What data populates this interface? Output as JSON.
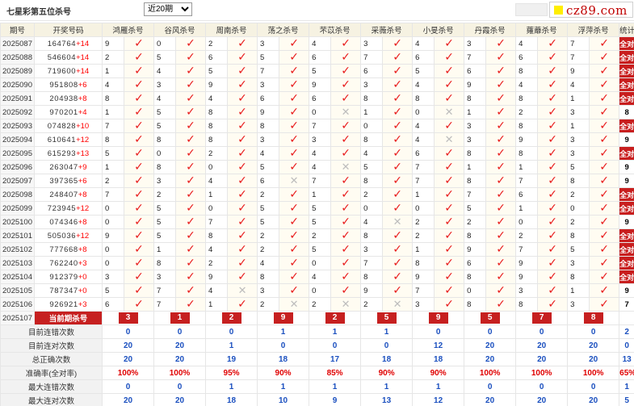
{
  "page": {
    "title": "七星彩第五位杀号",
    "period_option": "近20期",
    "logo_text": "cz89.com"
  },
  "headers": [
    "期号",
    "开奖号码",
    "鸿雁杀号",
    "谷风杀号",
    "周南杀号",
    "荡之杀号",
    "芣苡杀号",
    "采薇杀号",
    "小旻杀号",
    "丹霞杀号",
    "蕹蘼杀号",
    "浮萍杀号",
    "统计"
  ],
  "rows": [
    {
      "period": "2025087",
      "draw": "164764",
      "sum": "+14",
      "cells": [
        {
          "v": "9",
          "ok": true
        },
        {
          "v": "0",
          "ok": true
        },
        {
          "v": "2",
          "ok": true
        },
        {
          "v": "3",
          "ok": true
        },
        {
          "v": "4",
          "ok": true
        },
        {
          "v": "3",
          "ok": true
        },
        {
          "v": "4",
          "ok": true
        },
        {
          "v": "3",
          "ok": true
        },
        {
          "v": "4",
          "ok": true
        },
        {
          "v": "7",
          "ok": true
        }
      ],
      "stat": "全对"
    },
    {
      "period": "2025088",
      "draw": "546604",
      "sum": "+14",
      "cells": [
        {
          "v": "2",
          "ok": true
        },
        {
          "v": "5",
          "ok": true
        },
        {
          "v": "6",
          "ok": true
        },
        {
          "v": "5",
          "ok": true
        },
        {
          "v": "6",
          "ok": true
        },
        {
          "v": "7",
          "ok": true
        },
        {
          "v": "6",
          "ok": true
        },
        {
          "v": "7",
          "ok": true
        },
        {
          "v": "6",
          "ok": true
        },
        {
          "v": "7",
          "ok": true
        }
      ],
      "stat": "全对"
    },
    {
      "period": "2025089",
      "draw": "719600",
      "sum": "+14",
      "cells": [
        {
          "v": "1",
          "ok": true
        },
        {
          "v": "4",
          "ok": true
        },
        {
          "v": "5",
          "ok": true
        },
        {
          "v": "7",
          "ok": true
        },
        {
          "v": "5",
          "ok": true
        },
        {
          "v": "6",
          "ok": true
        },
        {
          "v": "5",
          "ok": true
        },
        {
          "v": "6",
          "ok": true
        },
        {
          "v": "8",
          "ok": true
        },
        {
          "v": "9",
          "ok": true
        }
      ],
      "stat": "全对"
    },
    {
      "period": "2025090",
      "draw": "951808",
      "sum": "+6",
      "cells": [
        {
          "v": "4",
          "ok": true
        },
        {
          "v": "3",
          "ok": true
        },
        {
          "v": "9",
          "ok": true
        },
        {
          "v": "3",
          "ok": true
        },
        {
          "v": "9",
          "ok": true
        },
        {
          "v": "3",
          "ok": true
        },
        {
          "v": "4",
          "ok": true
        },
        {
          "v": "9",
          "ok": true
        },
        {
          "v": "4",
          "ok": true
        },
        {
          "v": "4",
          "ok": true
        }
      ],
      "stat": "全对"
    },
    {
      "period": "2025091",
      "draw": "204938",
      "sum": "+8",
      "cells": [
        {
          "v": "8",
          "ok": true
        },
        {
          "v": "4",
          "ok": true
        },
        {
          "v": "4",
          "ok": true
        },
        {
          "v": "6",
          "ok": true
        },
        {
          "v": "6",
          "ok": true
        },
        {
          "v": "8",
          "ok": true
        },
        {
          "v": "8",
          "ok": true
        },
        {
          "v": "8",
          "ok": true
        },
        {
          "v": "8",
          "ok": true
        },
        {
          "v": "1",
          "ok": true
        }
      ],
      "stat": "全对"
    },
    {
      "period": "2025092",
      "draw": "970201",
      "sum": "+4",
      "cells": [
        {
          "v": "1",
          "ok": true
        },
        {
          "v": "5",
          "ok": true
        },
        {
          "v": "8",
          "ok": true
        },
        {
          "v": "9",
          "ok": true
        },
        {
          "v": "0",
          "ok": false
        },
        {
          "v": "1",
          "ok": true
        },
        {
          "v": "0",
          "ok": false
        },
        {
          "v": "1",
          "ok": true
        },
        {
          "v": "2",
          "ok": true
        },
        {
          "v": "3",
          "ok": true
        }
      ],
      "stat": "8"
    },
    {
      "period": "2025093",
      "draw": "074828",
      "sum": "+10",
      "cells": [
        {
          "v": "7",
          "ok": true
        },
        {
          "v": "5",
          "ok": true
        },
        {
          "v": "8",
          "ok": true
        },
        {
          "v": "8",
          "ok": true
        },
        {
          "v": "7",
          "ok": true
        },
        {
          "v": "0",
          "ok": true
        },
        {
          "v": "4",
          "ok": true
        },
        {
          "v": "3",
          "ok": true
        },
        {
          "v": "8",
          "ok": true
        },
        {
          "v": "1",
          "ok": true
        }
      ],
      "stat": "全对"
    },
    {
      "period": "2025094",
      "draw": "610641",
      "sum": "+12",
      "cells": [
        {
          "v": "8",
          "ok": true
        },
        {
          "v": "8",
          "ok": true
        },
        {
          "v": "8",
          "ok": true
        },
        {
          "v": "3",
          "ok": true
        },
        {
          "v": "3",
          "ok": true
        },
        {
          "v": "8",
          "ok": true
        },
        {
          "v": "4",
          "ok": false
        },
        {
          "v": "3",
          "ok": true
        },
        {
          "v": "9",
          "ok": true
        },
        {
          "v": "3",
          "ok": true
        }
      ],
      "stat": "9"
    },
    {
      "period": "2025095",
      "draw": "615293",
      "sum": "+13",
      "cells": [
        {
          "v": "5",
          "ok": true
        },
        {
          "v": "0",
          "ok": true
        },
        {
          "v": "2",
          "ok": true
        },
        {
          "v": "4",
          "ok": true
        },
        {
          "v": "4",
          "ok": true
        },
        {
          "v": "4",
          "ok": true
        },
        {
          "v": "6",
          "ok": true
        },
        {
          "v": "8",
          "ok": true
        },
        {
          "v": "8",
          "ok": true
        },
        {
          "v": "3",
          "ok": true
        }
      ],
      "stat": "全对"
    },
    {
      "period": "2025096",
      "draw": "263047",
      "sum": "+9",
      "cells": [
        {
          "v": "1",
          "ok": true
        },
        {
          "v": "8",
          "ok": true
        },
        {
          "v": "0",
          "ok": true
        },
        {
          "v": "5",
          "ok": true
        },
        {
          "v": "4",
          "ok": false
        },
        {
          "v": "5",
          "ok": true
        },
        {
          "v": "7",
          "ok": true
        },
        {
          "v": "1",
          "ok": true
        },
        {
          "v": "1",
          "ok": true
        },
        {
          "v": "5",
          "ok": true
        }
      ],
      "stat": "9"
    },
    {
      "period": "2025097",
      "draw": "397365",
      "sum": "+6",
      "cells": [
        {
          "v": "2",
          "ok": true
        },
        {
          "v": "3",
          "ok": true
        },
        {
          "v": "4",
          "ok": true
        },
        {
          "v": "6",
          "ok": false
        },
        {
          "v": "7",
          "ok": true
        },
        {
          "v": "8",
          "ok": true
        },
        {
          "v": "7",
          "ok": true
        },
        {
          "v": "8",
          "ok": true
        },
        {
          "v": "7",
          "ok": true
        },
        {
          "v": "8",
          "ok": true
        }
      ],
      "stat": "9"
    },
    {
      "period": "2025098",
      "draw": "248407",
      "sum": "+8",
      "cells": [
        {
          "v": "7",
          "ok": true
        },
        {
          "v": "2",
          "ok": true
        },
        {
          "v": "1",
          "ok": true
        },
        {
          "v": "2",
          "ok": true
        },
        {
          "v": "1",
          "ok": true
        },
        {
          "v": "2",
          "ok": true
        },
        {
          "v": "1",
          "ok": true
        },
        {
          "v": "7",
          "ok": true
        },
        {
          "v": "6",
          "ok": true
        },
        {
          "v": "2",
          "ok": true
        }
      ],
      "stat": "全对"
    },
    {
      "period": "2025099",
      "draw": "723945",
      "sum": "+12",
      "cells": [
        {
          "v": "0",
          "ok": true
        },
        {
          "v": "5",
          "ok": true
        },
        {
          "v": "0",
          "ok": true
        },
        {
          "v": "5",
          "ok": true
        },
        {
          "v": "5",
          "ok": true
        },
        {
          "v": "0",
          "ok": true
        },
        {
          "v": "0",
          "ok": true
        },
        {
          "v": "5",
          "ok": true
        },
        {
          "v": "1",
          "ok": true
        },
        {
          "v": "0",
          "ok": true
        }
      ],
      "stat": "全对"
    },
    {
      "period": "2025100",
      "draw": "074346",
      "sum": "+8",
      "cells": [
        {
          "v": "0",
          "ok": true
        },
        {
          "v": "5",
          "ok": true
        },
        {
          "v": "7",
          "ok": true
        },
        {
          "v": "5",
          "ok": true
        },
        {
          "v": "5",
          "ok": true
        },
        {
          "v": "4",
          "ok": false
        },
        {
          "v": "2",
          "ok": true
        },
        {
          "v": "2",
          "ok": true
        },
        {
          "v": "0",
          "ok": true
        },
        {
          "v": "2",
          "ok": true
        }
      ],
      "stat": "9"
    },
    {
      "period": "2025101",
      "draw": "505036",
      "sum": "+12",
      "cells": [
        {
          "v": "9",
          "ok": true
        },
        {
          "v": "5",
          "ok": true
        },
        {
          "v": "8",
          "ok": true
        },
        {
          "v": "2",
          "ok": true
        },
        {
          "v": "2",
          "ok": true
        },
        {
          "v": "8",
          "ok": true
        },
        {
          "v": "2",
          "ok": true
        },
        {
          "v": "8",
          "ok": true
        },
        {
          "v": "2",
          "ok": true
        },
        {
          "v": "8",
          "ok": true
        }
      ],
      "stat": "全对"
    },
    {
      "period": "2025102",
      "draw": "777668",
      "sum": "+8",
      "cells": [
        {
          "v": "0",
          "ok": true
        },
        {
          "v": "1",
          "ok": true
        },
        {
          "v": "4",
          "ok": true
        },
        {
          "v": "2",
          "ok": true
        },
        {
          "v": "5",
          "ok": true
        },
        {
          "v": "3",
          "ok": true
        },
        {
          "v": "1",
          "ok": true
        },
        {
          "v": "9",
          "ok": true
        },
        {
          "v": "7",
          "ok": true
        },
        {
          "v": "5",
          "ok": true
        }
      ],
      "stat": "全对"
    },
    {
      "period": "2025103",
      "draw": "762240",
      "sum": "+3",
      "cells": [
        {
          "v": "0",
          "ok": true
        },
        {
          "v": "8",
          "ok": true
        },
        {
          "v": "2",
          "ok": true
        },
        {
          "v": "4",
          "ok": true
        },
        {
          "v": "0",
          "ok": true
        },
        {
          "v": "7",
          "ok": true
        },
        {
          "v": "8",
          "ok": true
        },
        {
          "v": "6",
          "ok": true
        },
        {
          "v": "9",
          "ok": true
        },
        {
          "v": "3",
          "ok": true
        }
      ],
      "stat": "全对"
    },
    {
      "period": "2025104",
      "draw": "912379",
      "sum": "+0",
      "cells": [
        {
          "v": "3",
          "ok": true
        },
        {
          "v": "3",
          "ok": true
        },
        {
          "v": "9",
          "ok": true
        },
        {
          "v": "8",
          "ok": true
        },
        {
          "v": "4",
          "ok": true
        },
        {
          "v": "8",
          "ok": true
        },
        {
          "v": "9",
          "ok": true
        },
        {
          "v": "8",
          "ok": true
        },
        {
          "v": "9",
          "ok": true
        },
        {
          "v": "8",
          "ok": true
        }
      ],
      "stat": "全对"
    },
    {
      "period": "2025105",
      "draw": "787347",
      "sum": "+0",
      "cells": [
        {
          "v": "5",
          "ok": true
        },
        {
          "v": "7",
          "ok": true
        },
        {
          "v": "4",
          "ok": false
        },
        {
          "v": "3",
          "ok": true
        },
        {
          "v": "0",
          "ok": true
        },
        {
          "v": "9",
          "ok": true
        },
        {
          "v": "7",
          "ok": true
        },
        {
          "v": "0",
          "ok": true
        },
        {
          "v": "3",
          "ok": true
        },
        {
          "v": "1",
          "ok": true
        }
      ],
      "stat": "9"
    },
    {
      "period": "2025106",
      "draw": "926921",
      "sum": "+3",
      "cells": [
        {
          "v": "6",
          "ok": true
        },
        {
          "v": "7",
          "ok": true
        },
        {
          "v": "1",
          "ok": true
        },
        {
          "v": "2",
          "ok": false
        },
        {
          "v": "2",
          "ok": false
        },
        {
          "v": "2",
          "ok": false
        },
        {
          "v": "3",
          "ok": true
        },
        {
          "v": "8",
          "ok": true
        },
        {
          "v": "8",
          "ok": true
        },
        {
          "v": "3",
          "ok": true
        }
      ],
      "stat": "7"
    }
  ],
  "current": {
    "period": "2025107",
    "label": "当前期杀号",
    "values": [
      "3",
      "1",
      "2",
      "9",
      "2",
      "5",
      "9",
      "5",
      "7",
      "8"
    ]
  },
  "summary": [
    {
      "label": "目前连错次数",
      "values": [
        "0",
        "0",
        "0",
        "1",
        "1",
        "1",
        "0",
        "0",
        "0",
        "0",
        "2"
      ],
      "color": "blue"
    },
    {
      "label": "目前连对次数",
      "values": [
        "20",
        "20",
        "1",
        "0",
        "0",
        "0",
        "12",
        "20",
        "20",
        "20",
        "0"
      ],
      "color": "blue"
    },
    {
      "label": "总正确次数",
      "values": [
        "20",
        "20",
        "19",
        "18",
        "17",
        "18",
        "18",
        "20",
        "20",
        "20",
        "13"
      ],
      "color": "blue"
    },
    {
      "label": "准确率(全对率)",
      "values": [
        "100%",
        "100%",
        "95%",
        "90%",
        "85%",
        "90%",
        "90%",
        "100%",
        "100%",
        "100%",
        "65%"
      ],
      "color": "red"
    },
    {
      "label": "最大连错次数",
      "values": [
        "0",
        "0",
        "1",
        "1",
        "1",
        "1",
        "1",
        "0",
        "0",
        "0",
        "1"
      ],
      "color": "blue"
    },
    {
      "label": "最大连对次数",
      "values": [
        "20",
        "20",
        "18",
        "10",
        "9",
        "13",
        "12",
        "20",
        "20",
        "20",
        "5"
      ],
      "color": "blue"
    }
  ]
}
